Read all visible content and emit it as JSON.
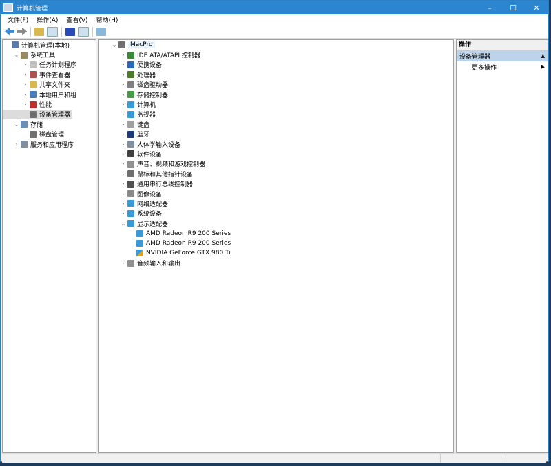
{
  "window": {
    "title": "计算机管理",
    "min": "–",
    "max": "☐",
    "close": "✕"
  },
  "menu": [
    "文件(F)",
    "操作(A)",
    "查看(V)",
    "帮助(H)"
  ],
  "left_tree": [
    {
      "label": "计算机管理(本地)",
      "level": 0,
      "chev": "",
      "color": "#5a7aa8"
    },
    {
      "label": "系统工具",
      "level": 1,
      "chev": "⌄",
      "color": "#9a8a60"
    },
    {
      "label": "任务计划程序",
      "level": 2,
      "chev": "›",
      "color": "#c0c0c0"
    },
    {
      "label": "事件查看器",
      "level": 2,
      "chev": "›",
      "color": "#b05050"
    },
    {
      "label": "共享文件夹",
      "level": 2,
      "chev": "›",
      "color": "#d9b850"
    },
    {
      "label": "本地用户和组",
      "level": 2,
      "chev": "›",
      "color": "#4a7ab8"
    },
    {
      "label": "性能",
      "level": 2,
      "chev": "›",
      "color": "#c03030"
    },
    {
      "label": "设备管理器",
      "level": 2,
      "chev": "",
      "color": "#707070",
      "selected": true
    },
    {
      "label": "存储",
      "level": 1,
      "chev": "⌄",
      "color": "#6a90b8"
    },
    {
      "label": "磁盘管理",
      "level": 2,
      "chev": "",
      "color": "#707070"
    },
    {
      "label": "服务和应用程序",
      "level": 1,
      "chev": "›",
      "color": "#8090a0"
    }
  ],
  "device_tree": [
    {
      "label": "MacPro",
      "level": 0,
      "chev": "⌄",
      "color": "#707070",
      "root": true
    },
    {
      "label": "IDE ATA/ATAPI 控制器",
      "level": 1,
      "chev": "›",
      "color": "#3a8a3a"
    },
    {
      "label": "便携设备",
      "level": 1,
      "chev": "›",
      "color": "#2a6ab8"
    },
    {
      "label": "处理器",
      "level": 1,
      "chev": "›",
      "color": "#4a7a2a"
    },
    {
      "label": "磁盘驱动器",
      "level": 1,
      "chev": "›",
      "color": "#808080"
    },
    {
      "label": "存储控制器",
      "level": 1,
      "chev": "›",
      "color": "#4a9a4a"
    },
    {
      "label": "计算机",
      "level": 1,
      "chev": "›",
      "color": "#3a9ad8"
    },
    {
      "label": "监视器",
      "level": 1,
      "chev": "›",
      "color": "#3a9ad8"
    },
    {
      "label": "键盘",
      "level": 1,
      "chev": "›",
      "color": "#a0a0a0"
    },
    {
      "label": "蓝牙",
      "level": 1,
      "chev": "›",
      "color": "#1a3a7a"
    },
    {
      "label": "人体学输入设备",
      "level": 1,
      "chev": "›",
      "color": "#8090a0"
    },
    {
      "label": "软件设备",
      "level": 1,
      "chev": "›",
      "color": "#404040"
    },
    {
      "label": "声音、视频和游戏控制器",
      "level": 1,
      "chev": "›",
      "color": "#909090"
    },
    {
      "label": "鼠标和其他指针设备",
      "level": 1,
      "chev": "›",
      "color": "#707070"
    },
    {
      "label": "通用串行总线控制器",
      "level": 1,
      "chev": "›",
      "color": "#505050"
    },
    {
      "label": "图像设备",
      "level": 1,
      "chev": "›",
      "color": "#8a8a8a"
    },
    {
      "label": "网络适配器",
      "level": 1,
      "chev": "›",
      "color": "#3a9ad8"
    },
    {
      "label": "系统设备",
      "level": 1,
      "chev": "›",
      "color": "#3a9ad8"
    },
    {
      "label": "显示适配器",
      "level": 1,
      "chev": "⌄",
      "color": "#3a9ad8"
    },
    {
      "label": "AMD Radeon R9 200 Series",
      "level": 2,
      "chev": "",
      "color": "#3a9ad8"
    },
    {
      "label": "AMD Radeon R9 200 Series",
      "level": 2,
      "chev": "",
      "color": "#3a9ad8"
    },
    {
      "label": "NVIDIA GeForce GTX 980 Ti",
      "level": 2,
      "chev": "",
      "color": "#e0a020",
      "warning": true
    },
    {
      "label": "音频输入和输出",
      "level": 1,
      "chev": "›",
      "color": "#909090"
    }
  ],
  "actions": {
    "header": "操作",
    "section": "设备管理器",
    "section_arrow": "▲",
    "item": "更多操作",
    "item_arrow": "▶"
  }
}
